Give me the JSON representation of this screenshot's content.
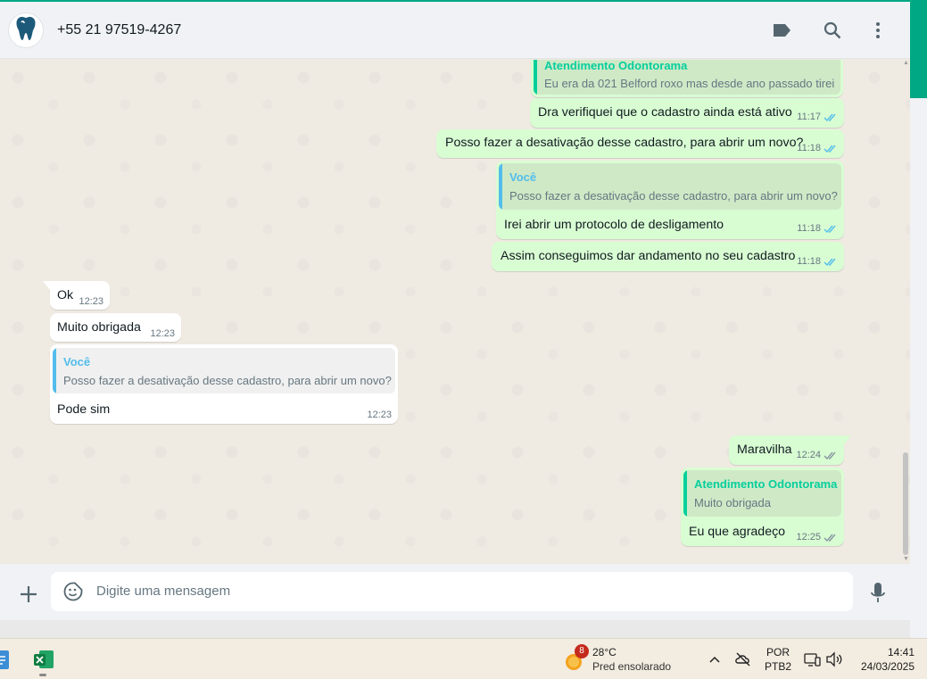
{
  "header": {
    "contact": "+55 21 97519-4267",
    "icons": [
      "tooth-logo-icon",
      "label-icon",
      "search-icon",
      "more-vertical-icon"
    ]
  },
  "messages": [
    {
      "id": "m1",
      "dir": "out",
      "quote": {
        "author": "Atendimento Odontorama",
        "text": "Eu era da 021 Belford roxo mas desde ano passado tirei"
      }
    },
    {
      "id": "m2",
      "dir": "out",
      "text": "Dra verifiquei que o cadastro ainda está ativo",
      "time": "11:17",
      "status": "read"
    },
    {
      "id": "m3",
      "dir": "out",
      "text": "Posso fazer a desativação desse cadastro, para abrir um novo?",
      "time": "11:18",
      "status": "read"
    },
    {
      "id": "m4",
      "dir": "out",
      "quote": {
        "author": "Você",
        "text": "Posso fazer a desativação desse cadastro, para abrir um novo?"
      },
      "text": "Irei abrir um protocolo de desligamento",
      "time": "11:18",
      "status": "read"
    },
    {
      "id": "m5",
      "dir": "out",
      "text": "Assim conseguimos dar andamento no seu cadastro",
      "time": "11:18",
      "status": "read"
    },
    {
      "id": "m6",
      "dir": "in",
      "text": "Ok",
      "time": "12:23"
    },
    {
      "id": "m7",
      "dir": "in",
      "text": "Muito obrigada",
      "time": "12:23"
    },
    {
      "id": "m8",
      "dir": "in",
      "quote": {
        "author": "Você",
        "text": "Posso fazer a desativação desse cadastro, para abrir um novo?"
      },
      "text": "Pode sim",
      "time": "12:23"
    },
    {
      "id": "m9",
      "dir": "out",
      "text": "Maravilha",
      "time": "12:24",
      "status": "delivered"
    },
    {
      "id": "m10",
      "dir": "out",
      "quote": {
        "author": "Atendimento Odontorama",
        "text": "Muito obrigada"
      },
      "text": "Eu que agradeço",
      "time": "12:25",
      "status": "delivered"
    }
  ],
  "composer": {
    "placeholder": "Digite uma mensagem"
  },
  "taskbar": {
    "weather_badge": "8",
    "weather_temp": "28°C",
    "weather_desc": "Pred ensolarado",
    "lang_line1": "POR",
    "lang_line2": "PTB2",
    "clock_time": "14:41",
    "clock_date": "24/03/2025"
  },
  "colors": {
    "accent": "#00a884",
    "outgoing": "#d9fdd3",
    "incoming": "#ffffff",
    "read_tick": "#53bdeb",
    "quote_you": "#53bdeb",
    "quote_other": "#06cf9c"
  }
}
